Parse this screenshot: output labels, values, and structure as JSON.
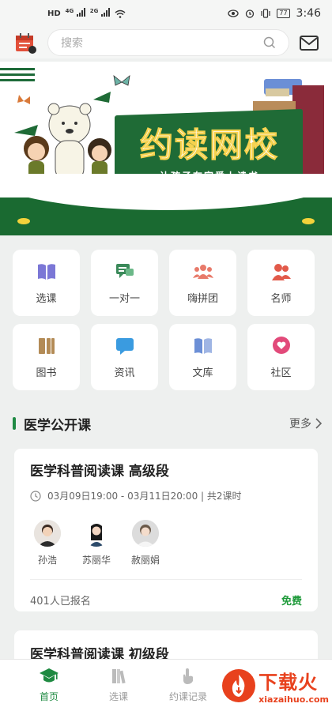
{
  "status": {
    "network_label": "HD",
    "signal1": "4G",
    "signal2": "2G",
    "battery": "77",
    "time": "3:46"
  },
  "header": {
    "search_placeholder": "搜索"
  },
  "banner": {
    "title": "约读网校",
    "subtitle": "让孩子在家爱上读书"
  },
  "grid": {
    "items": [
      {
        "label": "选课",
        "icon": "book-icon",
        "color": "#7b77d6"
      },
      {
        "label": "一对一",
        "icon": "chat-icon",
        "color": "#3b8a5a"
      },
      {
        "label": "嗨拼团",
        "icon": "group-icon",
        "color": "#e87a6a"
      },
      {
        "label": "名师",
        "icon": "teacher-icon",
        "color": "#e25a4a"
      },
      {
        "label": "图书",
        "icon": "books-icon",
        "color": "#b38b56"
      },
      {
        "label": "资讯",
        "icon": "message-icon",
        "color": "#3a9be0"
      },
      {
        "label": "文库",
        "icon": "library-icon",
        "color": "#6c8fd6"
      },
      {
        "label": "社区",
        "icon": "heart-bubble-icon",
        "color": "#e24a7a"
      }
    ]
  },
  "section": {
    "title": "医学公开课",
    "more": "更多"
  },
  "courses": [
    {
      "title": "医学科普阅读课  高级段",
      "time": "03月09日19:00 - 03月11日20:00 | 共2课时",
      "teachers": [
        "孙浩",
        "苏丽华",
        "赦丽娟"
      ],
      "enrolled": "401人已报名",
      "price": "免费"
    },
    {
      "title": "医学科普阅读课 初级段"
    }
  ],
  "nav": {
    "items": [
      "首页",
      "选课",
      "约课记录"
    ]
  },
  "watermark": {
    "cn": "下载火",
    "url": "xiazaihuo.com"
  },
  "colors": {
    "brand_green": "#1f6b36",
    "accent_green": "#1e9a3a",
    "watermark_red": "#e8411d"
  }
}
